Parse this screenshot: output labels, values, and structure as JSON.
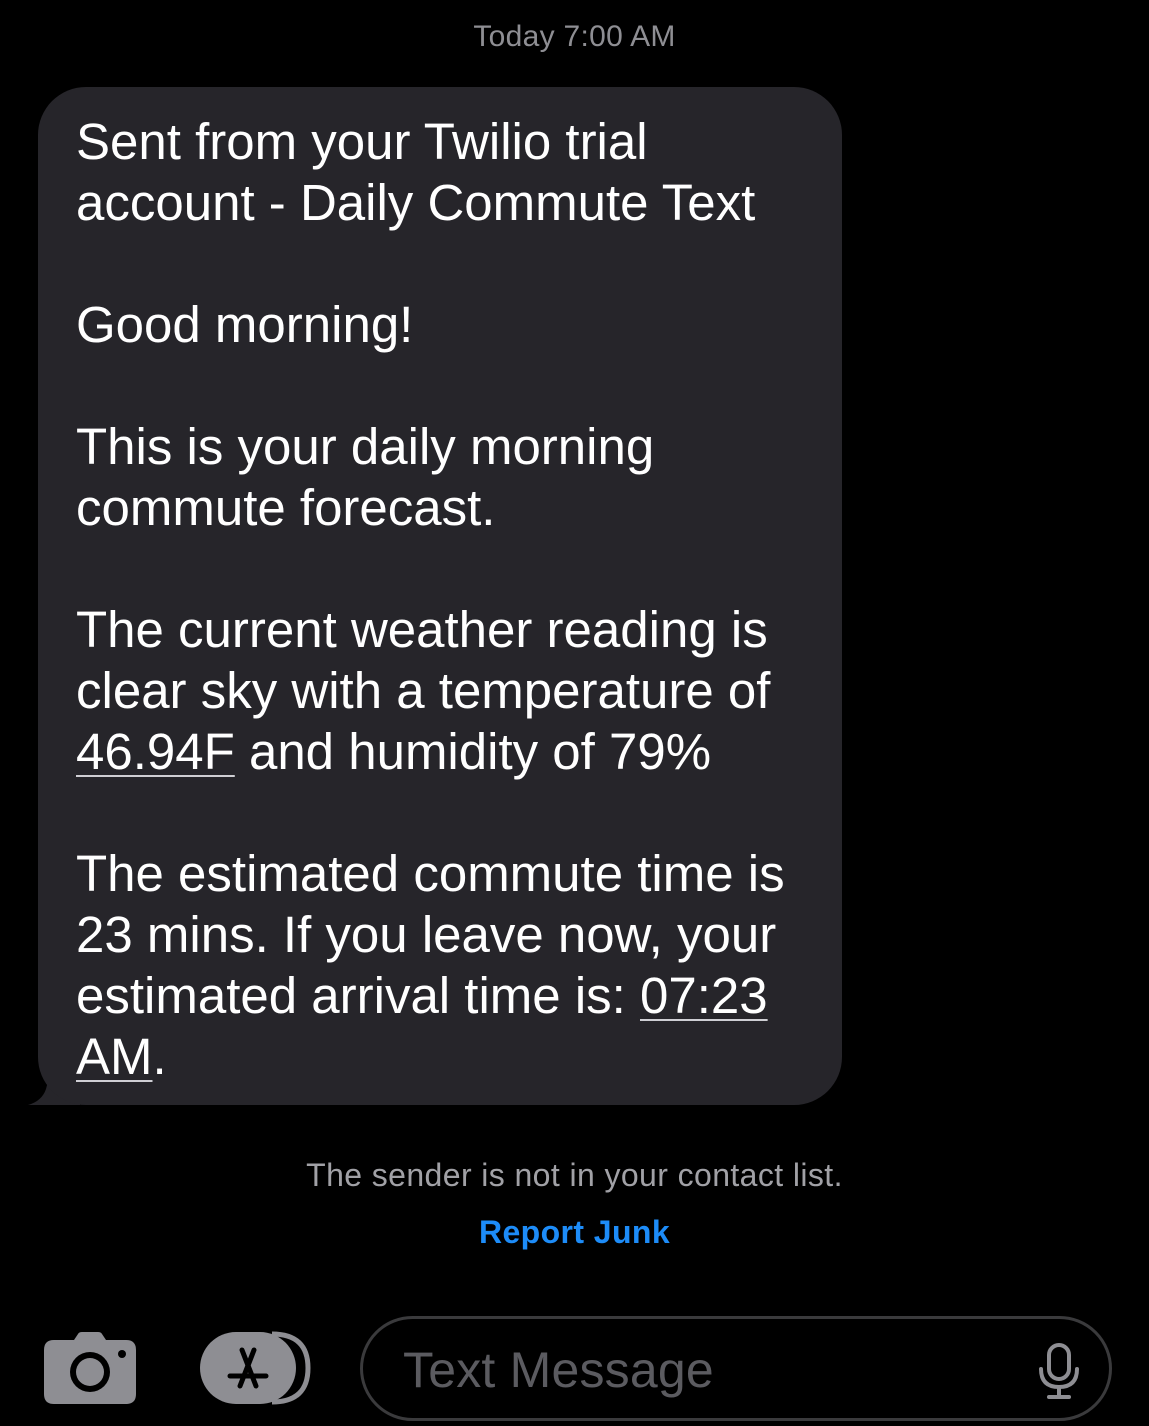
{
  "header": {
    "timestamp": "Today 7:00 AM"
  },
  "message": {
    "paragraphs": [
      {
        "lines": [
          "Sent from your Twilio trial",
          "account - Daily Commute Text"
        ]
      },
      {
        "lines": [
          "Good morning!"
        ]
      },
      {
        "lines": [
          "This is your daily morning",
          "commute forecast."
        ]
      }
    ],
    "weather": {
      "line1": "The current weather reading is",
      "line2": "clear sky with a temperature of",
      "temperature": "46.94F",
      "line3_rest": " and humidity of 79%"
    },
    "commute": {
      "line1": "The estimated commute time is",
      "line2": "23 mins. If you leave now, your",
      "line3_prefix": "estimated arrival time is: ",
      "arrival_time_part1": "07:23",
      "arrival_time_part2": "AM",
      "arrival_suffix": "."
    }
  },
  "notice": {
    "text": "The sender is not in your contact list.",
    "action": "Report Junk",
    "action_color": "#1d8cf8"
  },
  "composer": {
    "camera_icon": "camera-icon",
    "apps_icon": "app-store-icon",
    "placeholder": "Text Message",
    "mic_icon": "microphone-icon"
  },
  "colors": {
    "background": "#000000",
    "bubble": "#26252a",
    "secondary_text": "#8e8e93"
  }
}
